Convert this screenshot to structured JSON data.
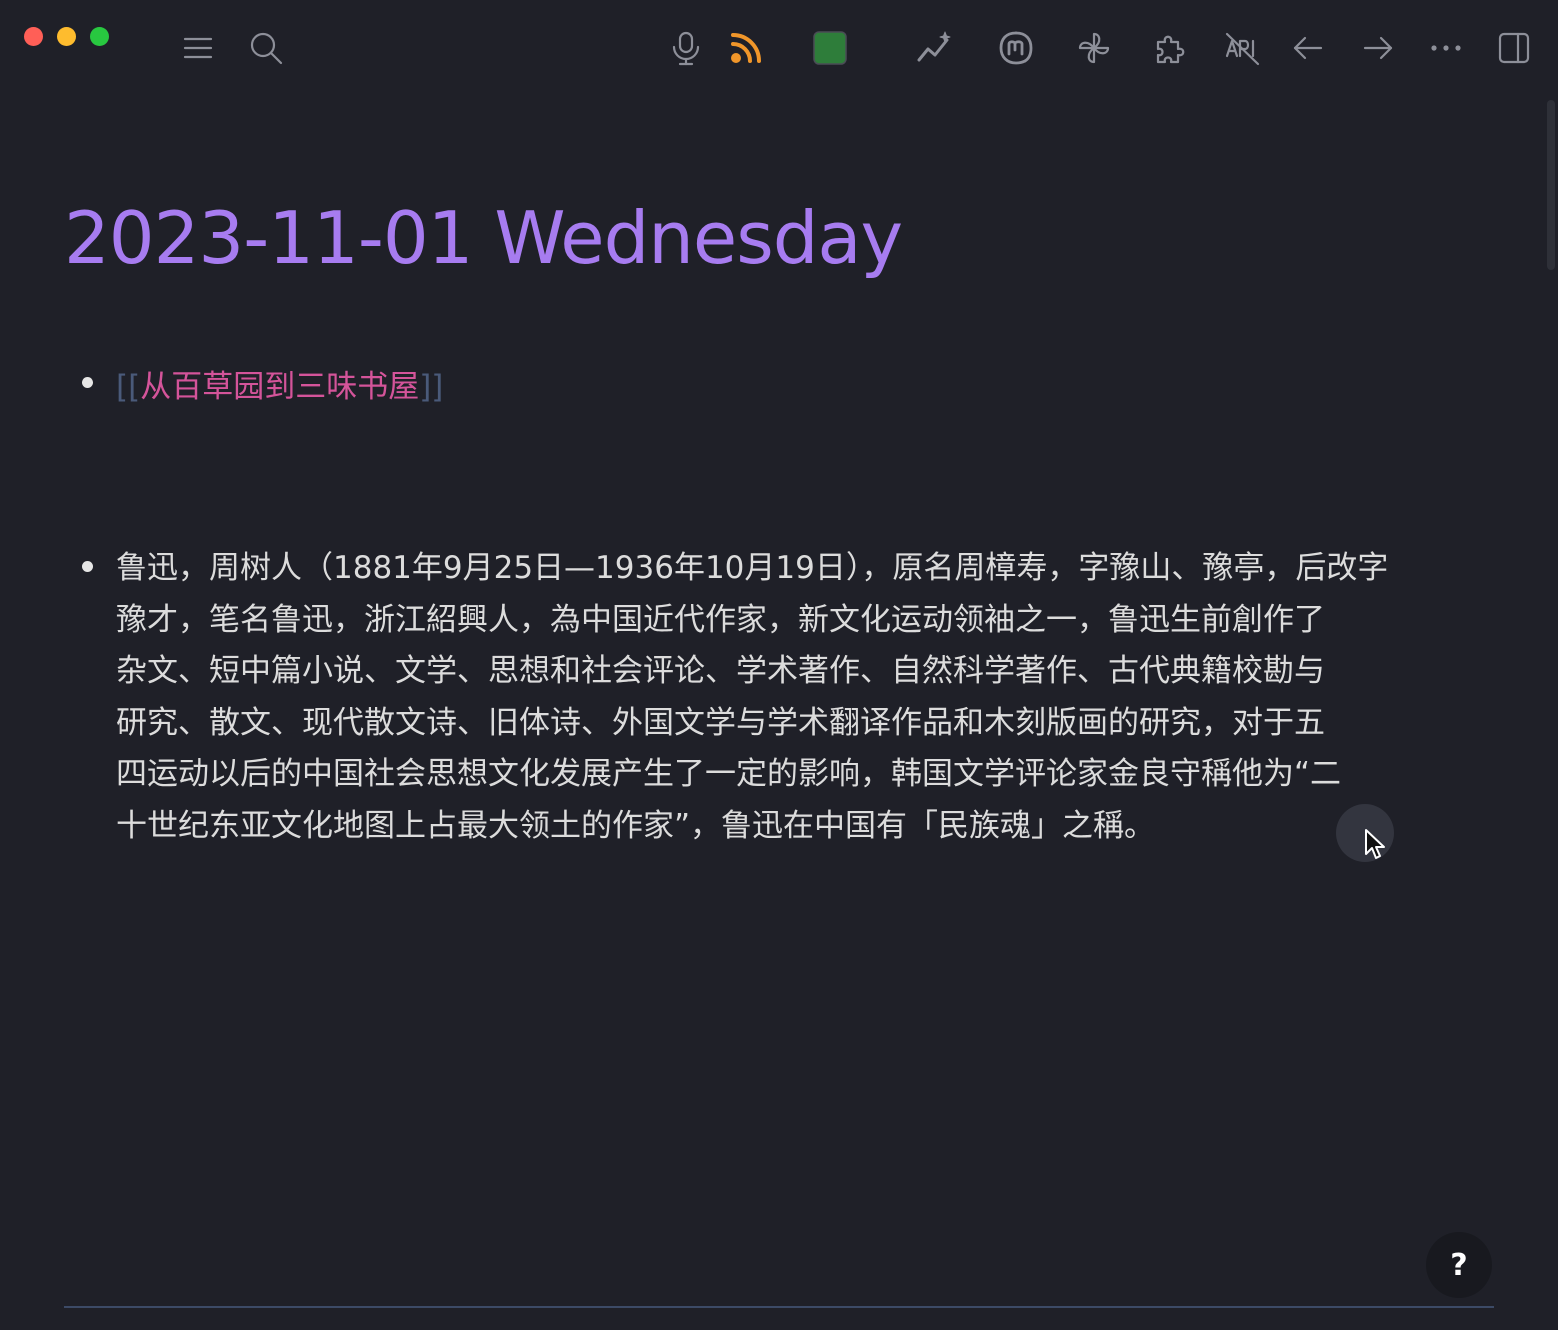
{
  "note": {
    "title": "2023-11-01 Wednesday",
    "link": {
      "open_bracket": "[[",
      "text": "从百草园到三味书屋",
      "close_bracket": "]]"
    },
    "paragraph_lines": [
      "鲁迅，周树人（1881年9月25日—1936年10月19日），原名周樟寿，字豫山、豫亭，后改字",
      "豫才，笔名鲁迅，浙江紹興人，為中国近代作家，新文化运动领袖之一，鲁迅生前創作了",
      "杂文、短中篇小说、文学、思想和社会评论、学术著作、自然科学著作、古代典籍校勘与",
      "研究、散文、现代散文诗、旧体诗、外国文学与学术翻译作品和木刻版画的研究，对于五",
      "四运动以后的中国社会思想文化发展产生了一定的影响，韩国文学评论家金良守稱他为“二",
      "十世纪东亚文化地图上占最大领土的作家”，鲁迅在中国有「民族魂」之稱。"
    ]
  },
  "help_button_label": "?",
  "colors": {
    "background": "#1f2028",
    "title": "#a77cf0",
    "link": "#d4549a",
    "rss": "#f0962a",
    "square": "#2e7d3a"
  },
  "toolbar_icons": [
    "menu-icon",
    "search-icon",
    "microphone-icon",
    "rss-icon",
    "green-square-icon",
    "sparkle-chart-icon",
    "mastodon-icon",
    "pinwheel-icon",
    "puzzle-icon",
    "api-off-icon",
    "arrow-left-icon",
    "arrow-right-icon",
    "more-icon",
    "sidebar-toggle-icon"
  ]
}
